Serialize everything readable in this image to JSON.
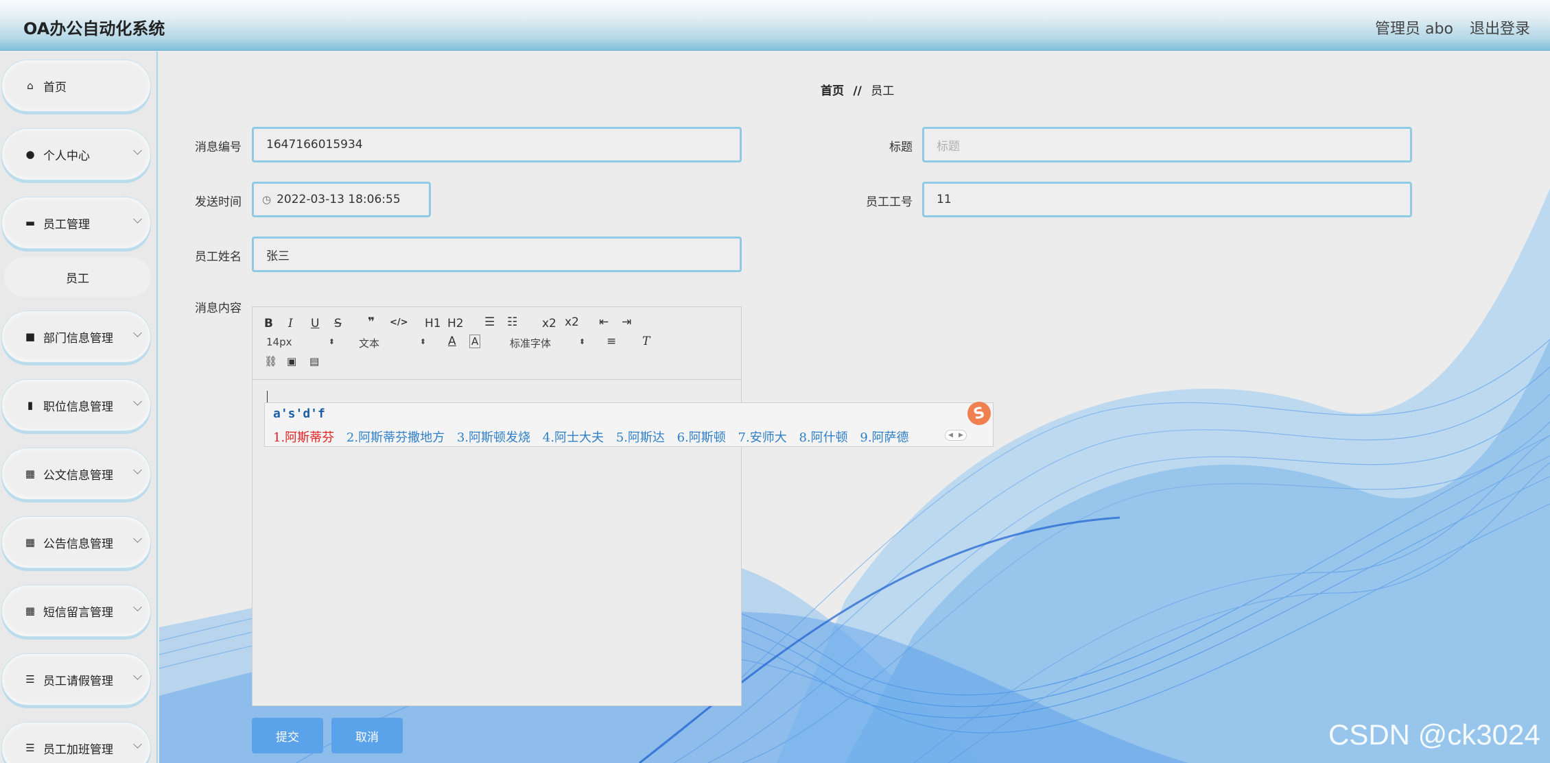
{
  "header": {
    "title": "OA办公自动化系统",
    "admin": "管理员 abo",
    "logout": "退出登录"
  },
  "sidebar": {
    "items": [
      {
        "label": "首页",
        "icon": "home-icon"
      },
      {
        "label": "个人中心",
        "icon": "user-icon"
      },
      {
        "label": "员工管理",
        "icon": "chat-icon"
      },
      {
        "label": "部门信息管理",
        "icon": "camera-icon"
      },
      {
        "label": "职位信息管理",
        "icon": "bar-chart-icon"
      },
      {
        "label": "公文信息管理",
        "icon": "grid-icon"
      },
      {
        "label": "公告信息管理",
        "icon": "grid-icon"
      },
      {
        "label": "短信留言管理",
        "icon": "grid-icon"
      },
      {
        "label": "员工请假管理",
        "icon": "list-icon"
      },
      {
        "label": "员工加班管理",
        "icon": "list-icon"
      }
    ],
    "sub_item": "员工"
  },
  "breadcrumb": {
    "home": "首页",
    "separator": "//",
    "current": "员工"
  },
  "form": {
    "msg_no_label": "消息编号",
    "msg_no_value": "1647166015934",
    "title_label": "标题",
    "title_placeholder": "标题",
    "send_time_label": "发送时间",
    "send_time_value": "2022-03-13 18:06:55",
    "emp_no_label": "员工工号",
    "emp_no_value": "11",
    "emp_name_label": "员工姓名",
    "emp_name_value": "张三",
    "content_label": "消息内容"
  },
  "editor": {
    "font_size": "14px",
    "text_type": "文本",
    "font_family": "标准字体",
    "tools": [
      "B",
      "I",
      "U",
      "S",
      "❞",
      "</>",
      "H1",
      "H2",
      "x2",
      "x2"
    ]
  },
  "ime": {
    "composition": "a's'd'f",
    "candidates": [
      "1.阿斯蒂芬",
      "2.阿斯蒂芬撒地方",
      "3.阿斯顿发烧",
      "4.阿士大夫",
      "5.阿斯达",
      "6.阿斯顿",
      "7.安师大",
      "8.阿什顿",
      "9.阿萨德"
    ],
    "logo": "S"
  },
  "buttons": {
    "submit": "提交",
    "cancel": "取消"
  },
  "watermark": "CSDN @ck3024",
  "colors": {
    "accent": "#5aa3ea",
    "input_border": "#8ecae3",
    "sidebar_border": "#a8d6ec"
  }
}
